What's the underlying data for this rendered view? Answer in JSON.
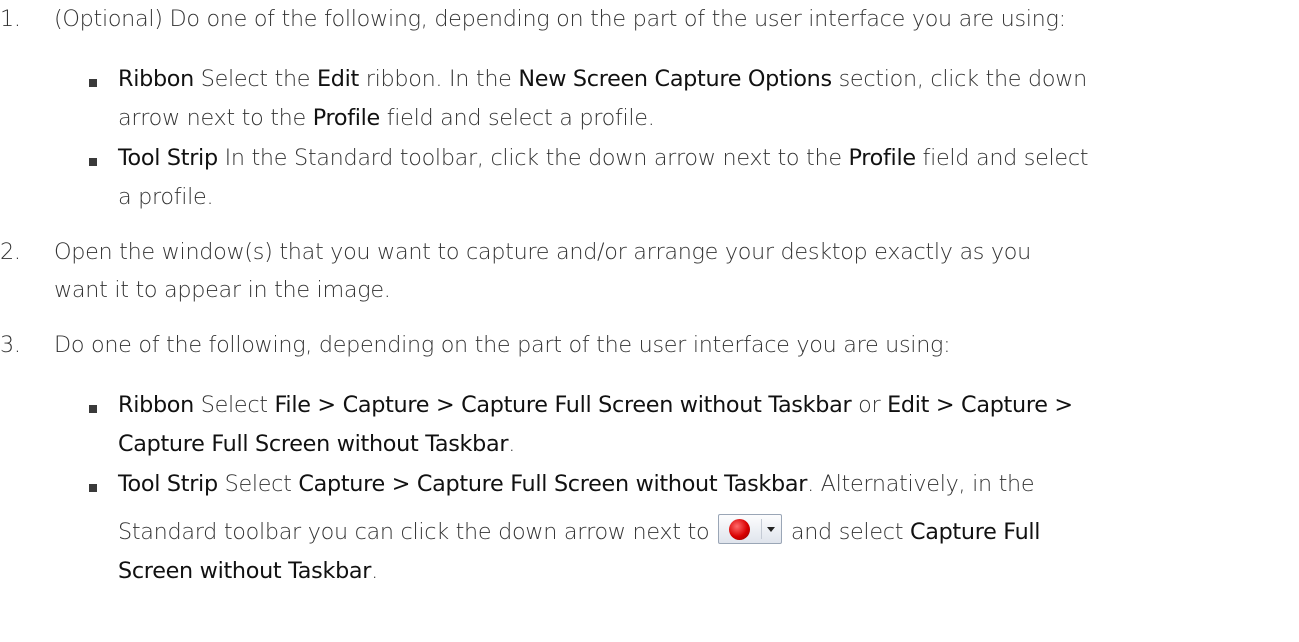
{
  "steps": [
    {
      "number": "1.",
      "text": "(Optional) Do one of the following, depending on the part of the user interface you are using:",
      "bullets": [
        {
          "lines": [
            [
              {
                "t": "Ribbon",
                "b": true
              },
              {
                "t": " Select the "
              },
              {
                "t": "Edit",
                "b": true
              },
              {
                "t": " ribbon. In the "
              },
              {
                "t": "New Screen Capture Options",
                "b": true
              },
              {
                "t": " section, click the down"
              }
            ],
            [
              {
                "t": "arrow next to the "
              },
              {
                "t": "Profile",
                "b": true
              },
              {
                "t": " field and select a profile."
              }
            ]
          ]
        },
        {
          "lines": [
            [
              {
                "t": "Tool Strip",
                "b": true
              },
              {
                "t": " In the Standard toolbar, click the down arrow next to the "
              },
              {
                "t": "Profile",
                "b": true
              },
              {
                "t": " field and select"
              }
            ],
            [
              {
                "t": "a profile."
              }
            ]
          ]
        }
      ]
    },
    {
      "number": "2.",
      "lines": [
        "Open the window(s) that you want to capture and/or arrange your desktop exactly as you",
        "want it to appear in the image."
      ]
    },
    {
      "number": "3.",
      "text": "Do one of the following, depending on the part of the user interface you are using:",
      "bullets": [
        {
          "lines": [
            [
              {
                "t": "Ribbon",
                "b": true
              },
              {
                "t": " Select "
              },
              {
                "t": "File > Capture > Capture Full Screen without Taskbar",
                "b": true
              },
              {
                "t": " or "
              },
              {
                "t": "Edit > Capture >",
                "b": true
              }
            ],
            [
              {
                "t": "Capture Full Screen without Taskbar",
                "b": true
              },
              {
                "t": "."
              }
            ]
          ]
        },
        {
          "lines": [
            [
              {
                "t": "Tool Strip",
                "b": true
              },
              {
                "t": " Select "
              },
              {
                "t": "Capture > Capture Full Screen without Taskbar",
                "b": true
              },
              {
                "t": ". Alternatively, in the"
              }
            ],
            [
              {
                "t": "Standard toolbar you can click the down arrow next to "
              },
              {
                "icon": "record-capture-button-icon"
              },
              {
                "t": " and select "
              },
              {
                "t": "Capture Full",
                "b": true
              }
            ],
            [
              {
                "t": "Screen without Taskbar",
                "b": true
              },
              {
                "t": "."
              }
            ]
          ]
        }
      ]
    }
  ]
}
